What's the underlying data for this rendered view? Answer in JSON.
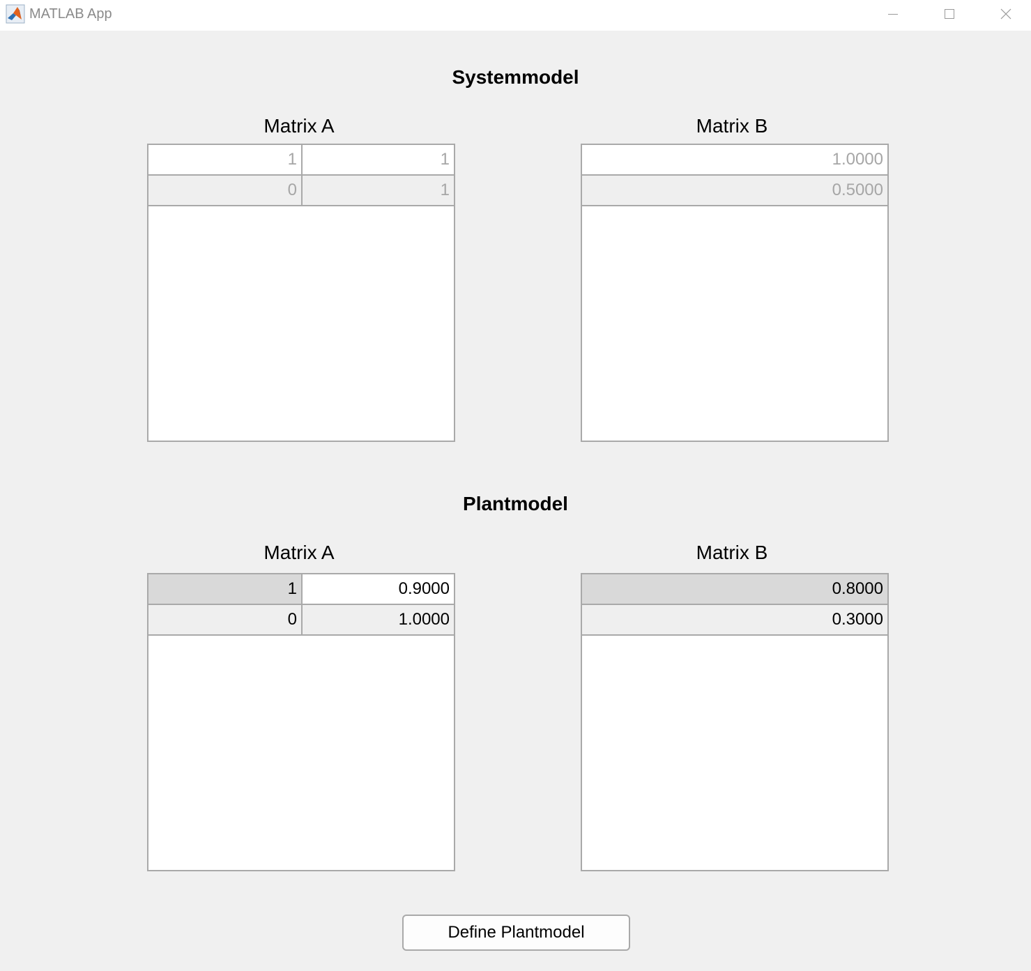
{
  "window": {
    "title": "MATLAB App",
    "icons": {
      "app": "matlab-logo-icon",
      "minimize": "minimize-icon",
      "maximize": "maximize-icon",
      "close": "close-icon"
    }
  },
  "system_model": {
    "title": "Systemmodel",
    "matrix_a": {
      "label": "Matrix A",
      "rows": [
        [
          "1",
          "1"
        ],
        [
          "0",
          "1"
        ]
      ]
    },
    "matrix_b": {
      "label": "Matrix B",
      "rows": [
        [
          "1.0000"
        ],
        [
          "0.5000"
        ]
      ]
    }
  },
  "plant_model": {
    "title": "Plantmodel",
    "matrix_a": {
      "label": "Matrix A",
      "rows": [
        [
          "1",
          "0.9000"
        ],
        [
          "0",
          "1.0000"
        ]
      ]
    },
    "matrix_b": {
      "label": "Matrix B",
      "rows": [
        [
          "0.8000"
        ],
        [
          "0.3000"
        ]
      ]
    }
  },
  "button": {
    "label": "Define Plantmodel"
  }
}
